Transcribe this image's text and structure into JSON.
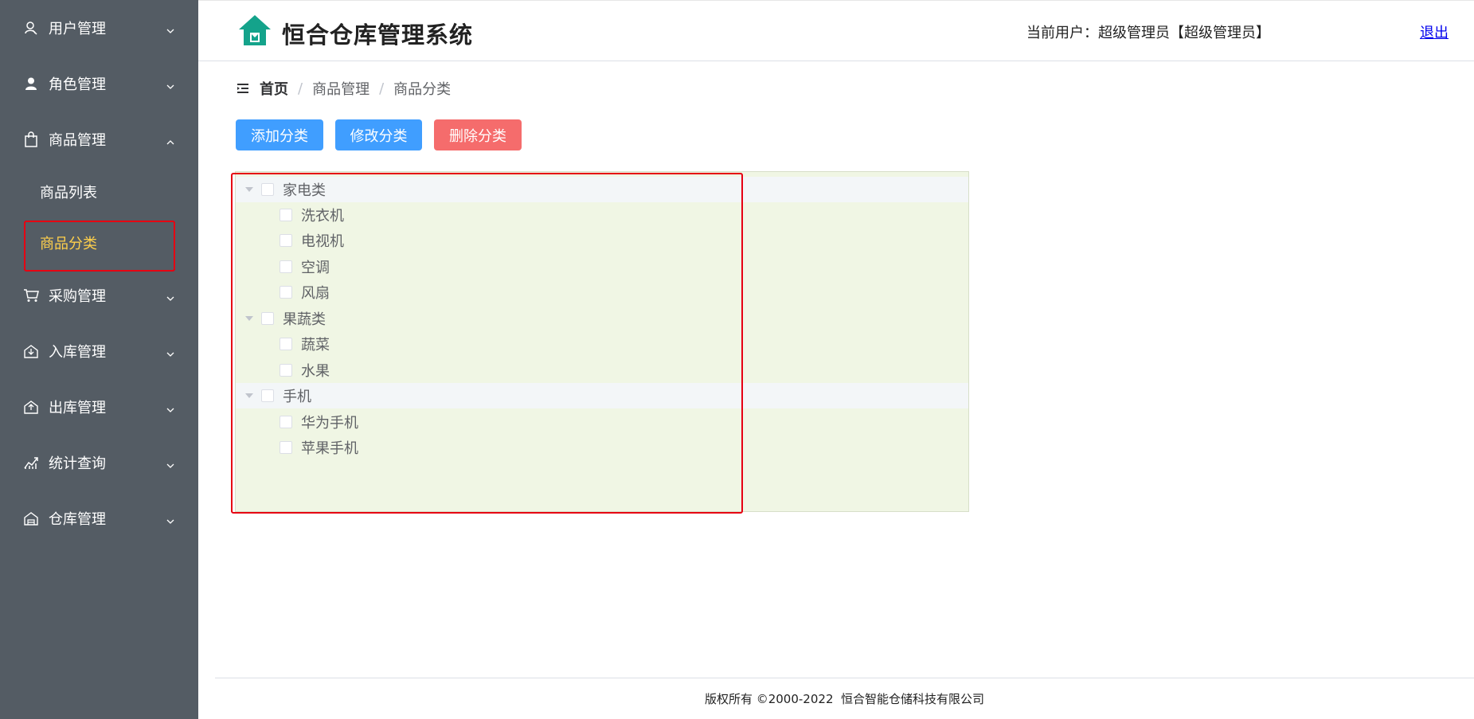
{
  "header": {
    "title": "恒合仓库管理系统",
    "user_info": "当前用户：超级管理员【超级管理员】",
    "logout": "退出"
  },
  "sidebar": {
    "items": [
      {
        "label": "用户管理",
        "icon": "user-outline-icon",
        "expanded": false
      },
      {
        "label": "角色管理",
        "icon": "role-person-icon",
        "expanded": false
      },
      {
        "label": "商品管理",
        "icon": "shopping-bag-icon",
        "expanded": true,
        "children": [
          {
            "label": "商品列表",
            "active": false
          },
          {
            "label": "商品分类",
            "active": true
          }
        ]
      },
      {
        "label": "采购管理",
        "icon": "cart-icon",
        "expanded": false
      },
      {
        "label": "入库管理",
        "icon": "stock-in-icon",
        "expanded": false
      },
      {
        "label": "出库管理",
        "icon": "stock-out-icon",
        "expanded": false
      },
      {
        "label": "统计查询",
        "icon": "trend-chart-icon",
        "expanded": false
      },
      {
        "label": "仓库管理",
        "icon": "warehouse-icon",
        "expanded": false
      }
    ],
    "active_color": "#ffd04b",
    "background": "#545c64"
  },
  "breadcrumb": {
    "items": [
      "首页",
      "商品管理",
      "商品分类"
    ]
  },
  "toolbar": {
    "add_label": "添加分类",
    "edit_label": "修改分类",
    "delete_label": "删除分类",
    "primary_color": "#409eff",
    "danger_color": "#f56c6c"
  },
  "tree": {
    "nodes": [
      {
        "label": "家电类",
        "children": [
          "洗衣机",
          "电视机",
          "空调",
          "风扇"
        ]
      },
      {
        "label": "果蔬类",
        "children": [
          "蔬菜",
          "水果"
        ]
      },
      {
        "label": "手机",
        "children": [
          "华为手机",
          "苹果手机"
        ]
      }
    ]
  },
  "footer": {
    "text": "版权所有 ©2000-2022  恒合智能仓储科技有限公司"
  }
}
